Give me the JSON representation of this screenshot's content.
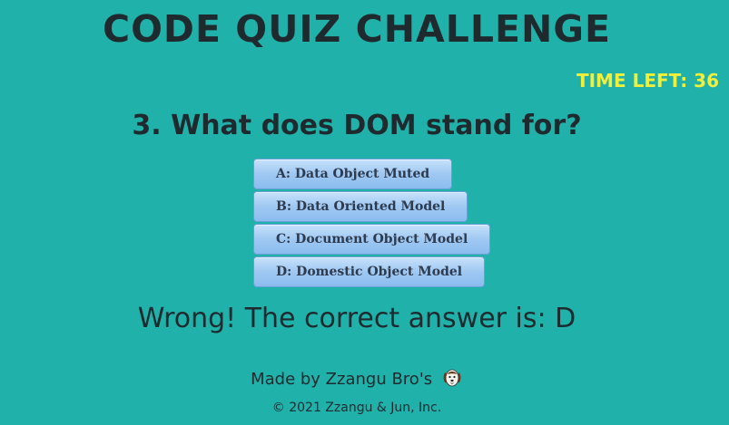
{
  "header": {
    "title": "CODE QUIZ CHALLENGE"
  },
  "timer": {
    "label": "TIME LEFT: 36",
    "color": "#f2ef3b"
  },
  "quiz": {
    "question": "3. What does DOM stand for?",
    "answers": [
      {
        "label": "A: Data Object Muted"
      },
      {
        "label": "B: Data Oriented Model"
      },
      {
        "label": "C: Document Object Model"
      },
      {
        "label": "D: Domestic Object Model"
      }
    ],
    "result": "Wrong! The correct answer is: D"
  },
  "footer": {
    "made_by": "Made by Zzangu Bro's",
    "icon": "dog-icon",
    "copyright": "© 2021 Zzangu & Jun, Inc."
  },
  "colors": {
    "background": "#20b2aa",
    "text": "#1f2a2e"
  }
}
